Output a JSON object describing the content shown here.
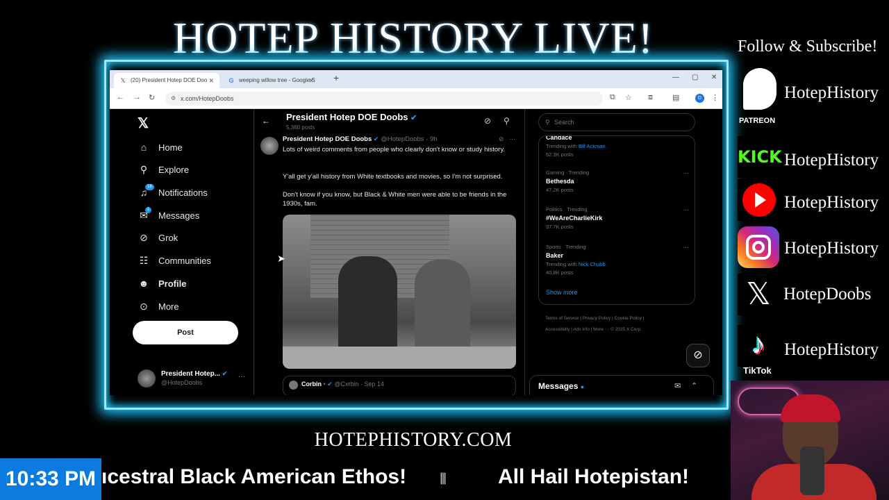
{
  "show_title": "HOTEP HISTORY LIVE!",
  "browser": {
    "tabs": [
      {
        "label": "(20) President Hotep DOE Doo",
        "favicon": "x-icon",
        "active": true
      },
      {
        "label": "weeping willow tree - Google S",
        "favicon": "google-icon",
        "active": false
      }
    ],
    "url": "x.com/HotepDoobs",
    "profile_initial": "D"
  },
  "x": {
    "nav": [
      {
        "label": "Home",
        "icon": "home-icon"
      },
      {
        "label": "Explore",
        "icon": "search-icon"
      },
      {
        "label": "Notifications",
        "icon": "bell-icon",
        "badge": "18"
      },
      {
        "label": "Messages",
        "icon": "envelope-icon",
        "badge": "1"
      },
      {
        "label": "Grok",
        "icon": "grok-icon"
      },
      {
        "label": "Communities",
        "icon": "people-icon"
      },
      {
        "label": "Profile",
        "icon": "person-icon"
      },
      {
        "label": "More",
        "icon": "more-circle-icon"
      }
    ],
    "post_button": "Post",
    "account": {
      "name": "President Hotep...",
      "handle": "@HotepDoobs"
    },
    "profile_header": {
      "name": "President Hotep DOE Doobs",
      "posts": "5,360 posts"
    },
    "tweet": {
      "name": "President Hotep DOE Doobs",
      "handle": "@HotepDoobs",
      "time": "9h",
      "lines": [
        "Lots of weird comments from people who clearly don't know or study history.",
        "Y'all get y'all history from White textbooks and movies, so I'm not surprised.",
        "Don't know if you know, but Black & White men were able to be friends in the 1930s, fam."
      ]
    },
    "quote": {
      "name": "Corbin",
      "handle": "@Cxrbin",
      "date": "Sep 14"
    },
    "search_placeholder": "Search",
    "trends": [
      {
        "category": "",
        "name": "Candace",
        "trending_with": "Trending with",
        "related": "Bill Ackman",
        "count": "52.3K posts"
      },
      {
        "category": "Gaming · Trending",
        "name": "Bethesda",
        "count": "47.2K posts"
      },
      {
        "category": "Politics · Trending",
        "name": "#WeAreCharlieKirk",
        "count": "37.7K posts"
      },
      {
        "category": "Sports · Trending",
        "name": "Baker",
        "trending_with": "Trending with",
        "related": "Nick Chubb",
        "count": "40.8K posts"
      }
    ],
    "show_more": "Show more",
    "footer": [
      "Terms of Service",
      "Privacy Policy",
      "Cookie Policy",
      "Accessibility",
      "Ads info",
      "More ···",
      "© 2025 X Corp."
    ],
    "messages_label": "Messages"
  },
  "social": {
    "heading": "Follow & Subscribe!",
    "accounts": [
      {
        "platform": "Patreon",
        "label": "PATREON",
        "handle": "HotepHistory"
      },
      {
        "platform": "Kick",
        "label": "KICK",
        "handle": "HotepHistory"
      },
      {
        "platform": "YouTube",
        "handle": "HotepHistory"
      },
      {
        "platform": "Instagram",
        "handle": "HotepHistory"
      },
      {
        "platform": "X",
        "handle": "HotepDoobs"
      },
      {
        "platform": "TikTok",
        "label": "TikTok",
        "handle": "HotepHistory"
      }
    ]
  },
  "website": "HOTEPHISTORY.COM",
  "ticker": {
    "time": "10:33 PM",
    "messages": [
      "ıcestral Black American Ethos!",
      "All Hail Hotepistan!"
    ]
  }
}
